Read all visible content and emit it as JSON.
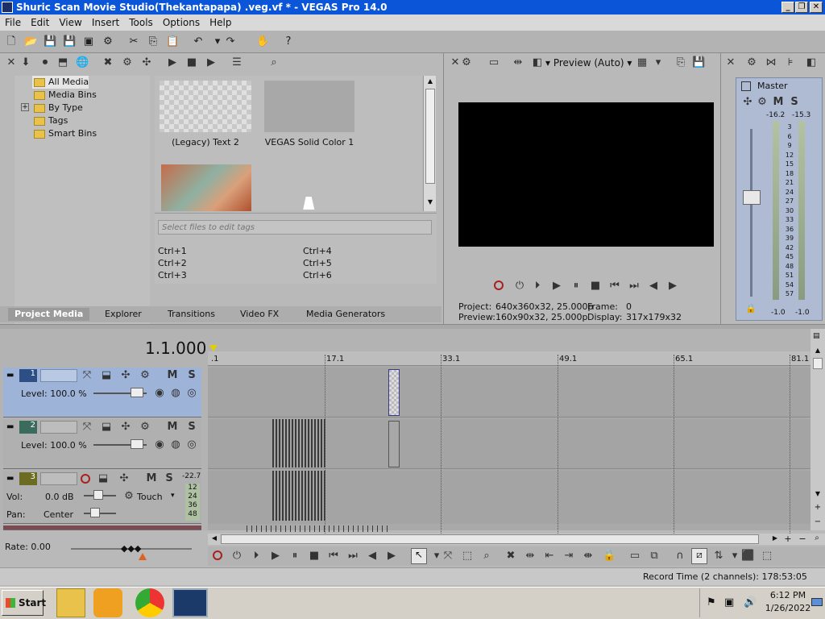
{
  "window": {
    "title": "Shuric Scan Movie Studio(Thekantapapa) .veg.vf * - VEGAS Pro 14.0"
  },
  "menu": [
    "File",
    "Edit",
    "View",
    "Insert",
    "Tools",
    "Options",
    "Help"
  ],
  "project_media": {
    "tree": [
      "All Media",
      "Media Bins",
      "By Type",
      "Tags",
      "Smart Bins"
    ],
    "thumbs": [
      {
        "label": "(Legacy) Text 2"
      },
      {
        "label": "VEGAS Solid Color 1"
      },
      {
        "label": ""
      }
    ],
    "tags_placeholder": "Select files to edit tags",
    "shortcuts": [
      "Ctrl+1",
      "Ctrl+2",
      "Ctrl+3",
      "Ctrl+4",
      "Ctrl+5",
      "Ctrl+6"
    ],
    "tabs": [
      "Project Media",
      "Explorer",
      "Transitions",
      "Video FX",
      "Media Generators"
    ]
  },
  "preview": {
    "mode": "Preview (Auto)",
    "project_label": "Project:",
    "project_value": "640x360x32, 25.000p",
    "preview_label": "Preview:",
    "preview_value": "160x90x32, 25.000p",
    "frame_label": "Frame:",
    "frame_value": "0",
    "display_label": "Display:",
    "display_value": "317x179x32"
  },
  "master": {
    "title": "Master",
    "m": "M",
    "s": "S",
    "peak_left": "-16.2",
    "peak_right": "-15.3",
    "scale": [
      "3",
      "6",
      "9",
      "12",
      "15",
      "18",
      "21",
      "24",
      "27",
      "30",
      "33",
      "36",
      "39",
      "42",
      "45",
      "48",
      "51",
      "54",
      "57"
    ],
    "bottom_left": "-1.0",
    "bottom_right": "-1.0"
  },
  "timeline": {
    "time": "1.1.000",
    "ruler": [
      ".1",
      "17.1",
      "33.1",
      "49.1",
      "65.1",
      "81.1"
    ],
    "tracks": [
      {
        "num": "1",
        "level": "Level: 100.0 %"
      },
      {
        "num": "2",
        "level": "Level: 100.0 %"
      },
      {
        "num": "3",
        "vol": "Vol:",
        "vol_value": "0.0 dB",
        "pan": "Pan:",
        "pan_value": "Center",
        "mode": "Touch",
        "meter": [
          "-22.7",
          "12",
          "24",
          "36",
          "48"
        ]
      }
    ],
    "m": "M",
    "s": "S",
    "rate": "Rate: 0.00",
    "record_time": "Record Time (2 channels): 178:53:05"
  },
  "taskbar": {
    "start": "Start",
    "time": "6:12 PM",
    "date": "1/26/2022"
  },
  "colors": {
    "titlebar": "#0b55d8",
    "track_selected": "#9db3d8",
    "video_black": "#000000"
  }
}
